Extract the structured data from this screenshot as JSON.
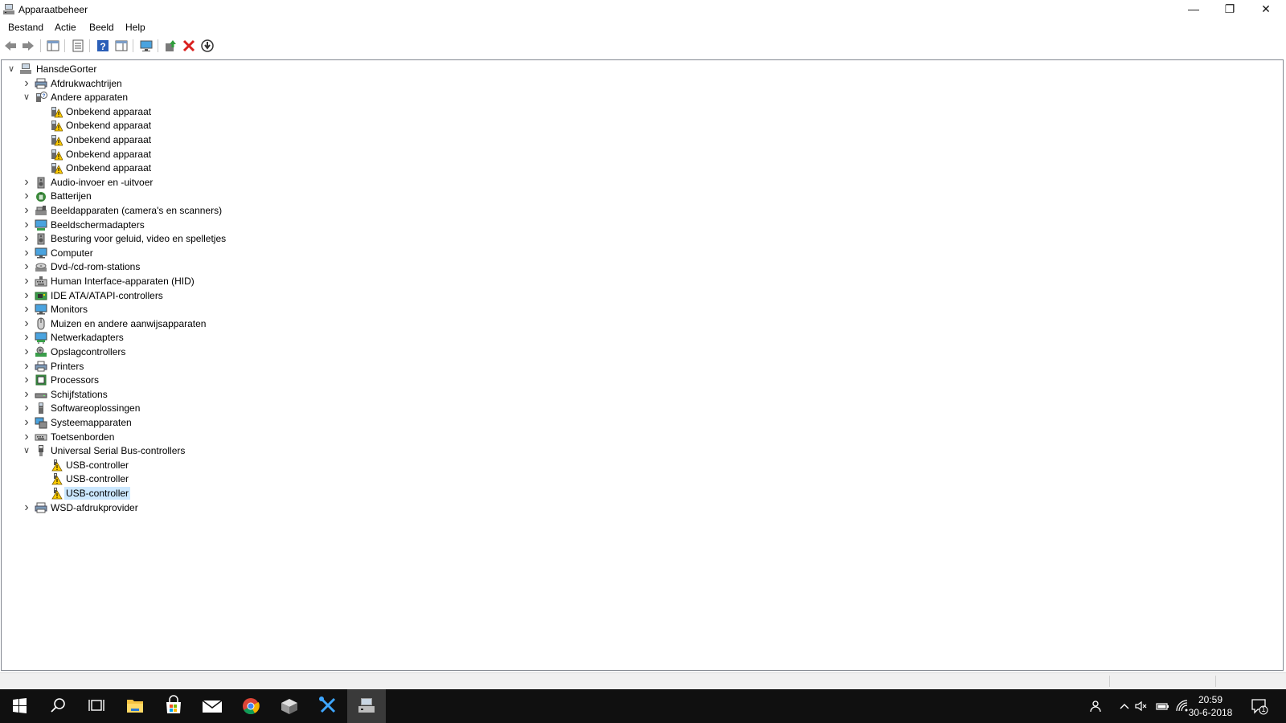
{
  "window": {
    "title": "Apparaatbeheer"
  },
  "menu": [
    "Bestand",
    "Actie",
    "Beeld",
    "Help"
  ],
  "toolbar": {
    "buttons": [
      "back-icon",
      "forward-icon",
      "console-tree-icon",
      "properties-icon",
      "help-icon",
      "action-pane-icon",
      "monitor-scan-icon",
      "update-driver-icon",
      "uninstall-icon",
      "download-icon"
    ]
  },
  "tree": {
    "root": "HansdeGorter",
    "items": [
      {
        "label": "Afdrukwachtrijen",
        "level": 1,
        "state": "collapsed",
        "icon": "print-queue-icon"
      },
      {
        "label": "Andere apparaten",
        "level": 1,
        "state": "expanded",
        "icon": "other-devices-icon"
      },
      {
        "label": "Onbekend apparaat",
        "level": 2,
        "state": "leaf",
        "icon": "warning-device-icon"
      },
      {
        "label": "Onbekend apparaat",
        "level": 2,
        "state": "leaf",
        "icon": "warning-device-icon"
      },
      {
        "label": "Onbekend apparaat",
        "level": 2,
        "state": "leaf",
        "icon": "warning-device-icon"
      },
      {
        "label": "Onbekend apparaat",
        "level": 2,
        "state": "leaf",
        "icon": "warning-device-icon"
      },
      {
        "label": "Onbekend apparaat",
        "level": 2,
        "state": "leaf",
        "icon": "warning-device-icon"
      },
      {
        "label": "Audio-invoer en -uitvoer",
        "level": 1,
        "state": "collapsed",
        "icon": "speaker-icon"
      },
      {
        "label": "Batterijen",
        "level": 1,
        "state": "collapsed",
        "icon": "battery-icon"
      },
      {
        "label": "Beeldapparaten (camera's en scanners)",
        "level": 1,
        "state": "collapsed",
        "icon": "camera-icon"
      },
      {
        "label": "Beeldschermadapters",
        "level": 1,
        "state": "collapsed",
        "icon": "display-adapter-icon"
      },
      {
        "label": "Besturing voor geluid, video en spelletjes",
        "level": 1,
        "state": "collapsed",
        "icon": "speaker-icon"
      },
      {
        "label": "Computer",
        "level": 1,
        "state": "collapsed",
        "icon": "monitor-icon"
      },
      {
        "label": "Dvd-/cd-rom-stations",
        "level": 1,
        "state": "collapsed",
        "icon": "disc-icon"
      },
      {
        "label": "Human Interface-apparaten (HID)",
        "level": 1,
        "state": "collapsed",
        "icon": "keyboard-hid-icon"
      },
      {
        "label": "IDE ATA/ATAPI-controllers",
        "level": 1,
        "state": "collapsed",
        "icon": "ide-controller-icon"
      },
      {
        "label": "Monitors",
        "level": 1,
        "state": "collapsed",
        "icon": "monitor-icon"
      },
      {
        "label": "Muizen en andere aanwijsapparaten",
        "level": 1,
        "state": "collapsed",
        "icon": "mouse-icon"
      },
      {
        "label": "Netwerkadapters",
        "level": 1,
        "state": "collapsed",
        "icon": "network-adapter-icon"
      },
      {
        "label": "Opslagcontrollers",
        "level": 1,
        "state": "collapsed",
        "icon": "storage-controller-icon"
      },
      {
        "label": "Printers",
        "level": 1,
        "state": "collapsed",
        "icon": "printer-icon"
      },
      {
        "label": "Processors",
        "level": 1,
        "state": "collapsed",
        "icon": "processor-icon"
      },
      {
        "label": "Schijfstations",
        "level": 1,
        "state": "collapsed",
        "icon": "disk-drive-icon"
      },
      {
        "label": "Softwareoplossingen",
        "level": 1,
        "state": "collapsed",
        "icon": "software-icon"
      },
      {
        "label": "Systeemapparaten",
        "level": 1,
        "state": "collapsed",
        "icon": "system-device-icon"
      },
      {
        "label": "Toetsenborden",
        "level": 1,
        "state": "collapsed",
        "icon": "keyboard-icon"
      },
      {
        "label": "Universal Serial Bus-controllers",
        "level": 1,
        "state": "expanded",
        "icon": "usb-icon"
      },
      {
        "label": "USB-controller",
        "level": 2,
        "state": "leaf",
        "icon": "warning-usb-icon"
      },
      {
        "label": "USB-controller",
        "level": 2,
        "state": "leaf",
        "icon": "warning-usb-icon"
      },
      {
        "label": "USB-controller",
        "level": 2,
        "state": "leaf",
        "icon": "warning-usb-icon",
        "selected": true
      },
      {
        "label": "WSD-afdrukprovider",
        "level": 1,
        "state": "collapsed",
        "icon": "print-queue-icon"
      }
    ]
  },
  "taskbar": {
    "apps": [
      "start-icon",
      "search-icon",
      "task-view-icon",
      "file-explorer-icon",
      "store-icon",
      "mail-icon",
      "chrome-icon",
      "app-box-icon",
      "tools-icon",
      "device-manager-icon"
    ],
    "clock_time": "20:59",
    "clock_date": "30-6-2018",
    "notification_count": "1"
  }
}
